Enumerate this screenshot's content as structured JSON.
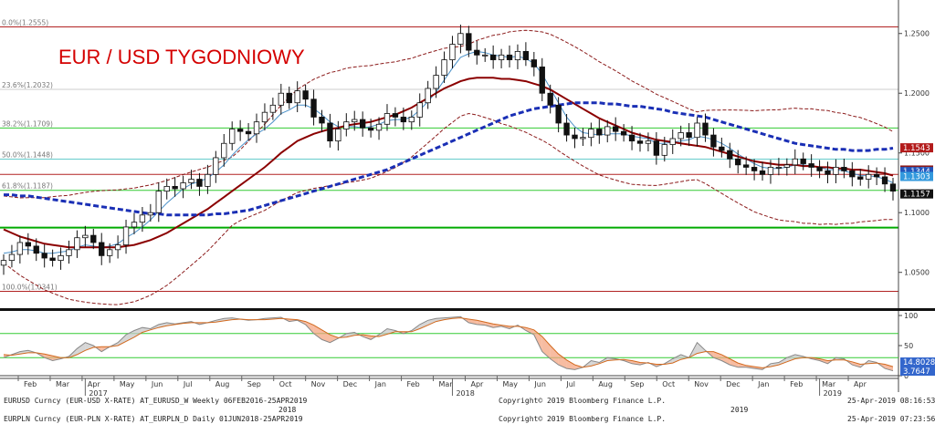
{
  "chart_data": {
    "type": "candlestick",
    "title": "EUR / USD TYGODNIOWY",
    "ylim": [
      1.02,
      1.275
    ],
    "y_ticks": [
      "1.2500",
      "1.2000",
      "1.1500",
      "1.1000",
      "1.0500"
    ],
    "y_tick_values": [
      1.25,
      1.2,
      1.15,
      1.1,
      1.05
    ],
    "month_labels": [
      "Feb",
      "Mar",
      "Apr",
      "May",
      "Jun",
      "Jul",
      "Aug",
      "Sep",
      "Oct",
      "Nov",
      "Dec",
      "Jan",
      "Feb",
      "Mar",
      "Apr",
      "May",
      "Jun",
      "Jul",
      "Aug",
      "Sep",
      "Oct",
      "Nov",
      "Dec",
      "Jan",
      "Feb",
      "Mar",
      "Apr"
    ],
    "year_labels": [
      {
        "text": "2017",
        "index": 10
      },
      {
        "text": "2018",
        "index": 55
      },
      {
        "text": "2019",
        "index": 100
      }
    ],
    "fib_levels": [
      {
        "label": "0.0%(1.2555)",
        "value": 1.2555,
        "color": "#b22222"
      },
      {
        "label": "23.6%(1.2032)",
        "value": 1.2032,
        "color": "#cccccc"
      },
      {
        "label": "38.2%(1.1709)",
        "value": 1.1709,
        "color": "#33cc33"
      },
      {
        "label": "50.0%(1.1448)",
        "value": 1.1448,
        "color": "#66cccc"
      },
      {
        "label": "61.8%(1.1187)",
        "value": 1.1187,
        "color": "#33cc33"
      },
      {
        "label": "",
        "value": 1.0875,
        "color": "#00aa00"
      },
      {
        "label": "100.0%(1.0341)",
        "value": 1.0341,
        "color": "#b22222"
      }
    ],
    "horizontal_lines": [
      {
        "value": 1.132,
        "color": "#b22222"
      }
    ],
    "right_tags": [
      {
        "text": "1.1543",
        "value": 1.1543,
        "color": "#b31b1b"
      },
      {
        "text": "1.1357",
        "value": 1.1357,
        "color": "#8b1a1a"
      },
      {
        "text": "1.1344",
        "value": 1.1344,
        "color": "#2255bb"
      },
      {
        "text": "1.1303",
        "value": 1.1303,
        "color": "#3399dd"
      },
      {
        "text": "1.1157",
        "value": 1.1157,
        "color": "#111111"
      }
    ],
    "close_series": [
      1.06,
      1.065,
      1.075,
      1.072,
      1.066,
      1.062,
      1.06,
      1.064,
      1.069,
      1.079,
      1.081,
      1.075,
      1.064,
      1.069,
      1.073,
      1.088,
      1.092,
      1.098,
      1.1,
      1.118,
      1.122,
      1.12,
      1.125,
      1.128,
      1.122,
      1.132,
      1.146,
      1.158,
      1.17,
      1.168,
      1.166,
      1.176,
      1.184,
      1.19,
      1.2,
      1.192,
      1.202,
      1.195,
      1.18,
      1.175,
      1.16,
      1.17,
      1.176,
      1.178,
      1.171,
      1.169,
      1.174,
      1.183,
      1.18,
      1.176,
      1.18,
      1.192,
      1.204,
      1.215,
      1.228,
      1.241,
      1.25,
      1.236,
      1.232,
      1.232,
      1.228,
      1.232,
      1.228,
      1.235,
      1.228,
      1.222,
      1.2,
      1.19,
      1.175,
      1.165,
      1.162,
      1.163,
      1.17,
      1.165,
      1.172,
      1.168,
      1.165,
      1.16,
      1.158,
      1.16,
      1.148,
      1.157,
      1.162,
      1.167,
      1.163,
      1.175,
      1.165,
      1.155,
      1.152,
      1.145,
      1.14,
      1.138,
      1.135,
      1.132,
      1.138,
      1.138,
      1.14,
      1.145,
      1.141,
      1.138,
      1.135,
      1.132,
      1.138,
      1.135,
      1.13,
      1.128,
      1.132,
      1.13,
      1.124,
      1.118
    ],
    "sma_short": [
      1.066,
      1.067,
      1.069,
      1.069,
      1.068,
      1.066,
      1.066,
      1.067,
      1.068,
      1.071,
      1.073,
      1.072,
      1.071,
      1.072,
      1.074,
      1.079,
      1.083,
      1.088,
      1.094,
      1.101,
      1.108,
      1.114,
      1.12,
      1.124,
      1.126,
      1.129,
      1.134,
      1.14,
      1.148,
      1.155,
      1.161,
      1.166,
      1.17,
      1.176,
      1.183,
      1.186,
      1.19,
      1.19,
      1.187,
      1.182,
      1.176,
      1.172,
      1.172,
      1.172,
      1.171,
      1.172,
      1.174,
      1.177,
      1.178,
      1.178,
      1.18,
      1.186,
      1.193,
      1.201,
      1.211,
      1.221,
      1.23,
      1.233,
      1.235,
      1.234,
      1.232,
      1.231,
      1.23,
      1.231,
      1.229,
      1.225,
      1.216,
      1.204,
      1.192,
      1.18,
      1.172,
      1.167,
      1.166,
      1.165,
      1.166,
      1.166,
      1.166,
      1.164,
      1.163,
      1.162,
      1.158,
      1.158,
      1.159,
      1.16,
      1.161,
      1.164,
      1.163,
      1.161,
      1.158,
      1.154,
      1.149,
      1.145,
      1.141,
      1.138,
      1.137,
      1.137,
      1.138,
      1.14,
      1.14,
      1.139,
      1.138,
      1.136,
      1.136,
      1.135,
      1.133,
      1.131,
      1.131,
      1.13,
      1.128,
      1.125
    ],
    "sma_mid": [
      1.086,
      1.083,
      1.08,
      1.078,
      1.076,
      1.074,
      1.073,
      1.072,
      1.071,
      1.071,
      1.071,
      1.071,
      1.071,
      1.071,
      1.071,
      1.072,
      1.073,
      1.075,
      1.077,
      1.08,
      1.083,
      1.087,
      1.091,
      1.095,
      1.099,
      1.103,
      1.108,
      1.113,
      1.118,
      1.123,
      1.128,
      1.133,
      1.138,
      1.144,
      1.15,
      1.155,
      1.16,
      1.163,
      1.166,
      1.168,
      1.17,
      1.171,
      1.173,
      1.174,
      1.175,
      1.176,
      1.178,
      1.18,
      1.182,
      1.185,
      1.188,
      1.192,
      1.196,
      1.2,
      1.204,
      1.207,
      1.21,
      1.212,
      1.213,
      1.213,
      1.213,
      1.212,
      1.212,
      1.211,
      1.21,
      1.208,
      1.206,
      1.203,
      1.199,
      1.195,
      1.191,
      1.187,
      1.183,
      1.179,
      1.176,
      1.173,
      1.17,
      1.167,
      1.165,
      1.163,
      1.161,
      1.16,
      1.159,
      1.158,
      1.157,
      1.156,
      1.155,
      1.153,
      1.151,
      1.149,
      1.147,
      1.145,
      1.143,
      1.142,
      1.141,
      1.14,
      1.14,
      1.14,
      1.139,
      1.139,
      1.138,
      1.138,
      1.137,
      1.137,
      1.136,
      1.136,
      1.135,
      1.134,
      1.133,
      1.131
    ],
    "sma_long": [
      1.115,
      1.115,
      1.114,
      1.114,
      1.113,
      1.112,
      1.111,
      1.11,
      1.109,
      1.108,
      1.107,
      1.106,
      1.105,
      1.104,
      1.103,
      1.102,
      1.101,
      1.1,
      1.099,
      1.099,
      1.098,
      1.098,
      1.098,
      1.098,
      1.098,
      1.098,
      1.099,
      1.099,
      1.1,
      1.101,
      1.102,
      1.104,
      1.106,
      1.108,
      1.11,
      1.112,
      1.114,
      1.116,
      1.118,
      1.12,
      1.122,
      1.124,
      1.126,
      1.128,
      1.13,
      1.132,
      1.134,
      1.136,
      1.139,
      1.142,
      1.145,
      1.148,
      1.151,
      1.154,
      1.157,
      1.16,
      1.163,
      1.166,
      1.169,
      1.172,
      1.175,
      1.178,
      1.181,
      1.183,
      1.185,
      1.187,
      1.188,
      1.189,
      1.19,
      1.191,
      1.192,
      1.192,
      1.192,
      1.192,
      1.191,
      1.191,
      1.19,
      1.189,
      1.189,
      1.188,
      1.187,
      1.186,
      1.184,
      1.183,
      1.182,
      1.181,
      1.18,
      1.178,
      1.176,
      1.174,
      1.172,
      1.17,
      1.168,
      1.166,
      1.164,
      1.162,
      1.16,
      1.158,
      1.157,
      1.156,
      1.155,
      1.154,
      1.153,
      1.153,
      1.152,
      1.152,
      1.152,
      1.153,
      1.153,
      1.154
    ],
    "oscillator": {
      "ylim": [
        0,
        100
      ],
      "y_ticks": [
        "100",
        "50",
        "0"
      ],
      "y_tick_values": [
        100,
        50,
        0
      ],
      "levels": [
        70,
        30
      ],
      "fast": [
        30,
        35,
        40,
        42,
        38,
        30,
        25,
        28,
        32,
        45,
        55,
        50,
        40,
        48,
        55,
        68,
        75,
        80,
        78,
        85,
        88,
        86,
        88,
        90,
        85,
        88,
        92,
        95,
        96,
        94,
        92,
        93,
        95,
        96,
        97,
        90,
        92,
        85,
        70,
        60,
        55,
        62,
        70,
        72,
        65,
        60,
        68,
        78,
        75,
        70,
        75,
        85,
        92,
        95,
        96,
        97,
        98,
        88,
        85,
        84,
        80,
        82,
        78,
        84,
        75,
        68,
        40,
        28,
        18,
        12,
        10,
        14,
        25,
        22,
        30,
        28,
        25,
        20,
        18,
        22,
        15,
        20,
        28,
        35,
        30,
        55,
        42,
        30,
        25,
        18,
        14,
        14,
        12,
        10,
        20,
        22,
        30,
        35,
        32,
        28,
        25,
        20,
        30,
        28,
        18,
        14,
        25,
        22,
        12,
        8
      ],
      "slow": [
        35,
        34,
        36,
        38,
        38,
        36,
        33,
        30,
        30,
        35,
        42,
        47,
        48,
        48,
        50,
        57,
        64,
        72,
        76,
        80,
        83,
        85,
        87,
        88,
        88,
        88,
        89,
        91,
        93,
        94,
        93,
        93,
        93,
        94,
        95,
        94,
        93,
        90,
        84,
        76,
        68,
        63,
        64,
        67,
        68,
        66,
        65,
        69,
        73,
        73,
        73,
        78,
        84,
        90,
        93,
        95,
        96,
        94,
        92,
        89,
        86,
        84,
        82,
        82,
        80,
        76,
        65,
        50,
        36,
        26,
        18,
        14,
        16,
        20,
        25,
        26,
        27,
        25,
        22,
        21,
        19,
        19,
        21,
        27,
        30,
        37,
        40,
        40,
        35,
        28,
        21,
        17,
        15,
        13,
        15,
        18,
        23,
        28,
        30,
        30,
        28,
        25,
        26,
        26,
        23,
        19,
        20,
        21,
        19,
        15
      ],
      "tags": [
        {
          "text": "14.8028",
          "color": "#3366cc"
        },
        {
          "text": "3.7647",
          "color": "#3366cc"
        }
      ]
    }
  },
  "footer": {
    "line1_left": "EURUSD Curncy (EUR-USD X-RATE) AT_EURUSD_W  Weekly 06FEB2016-25APR2019",
    "line1_mid": "Copyright© 2019 Bloomberg Finance L.P.",
    "line1_right": "25-Apr-2019 08:16:53",
    "line2_left": "EURPLN Curncy (EUR-PLN X-RATE) AT_EURPLN_D  Daily 01JUN2018-25APR2019",
    "line2_mid": "Copyright© 2019 Bloomberg Finance L.P.",
    "line2_right": "25-Apr-2019 07:23:56",
    "year_2018": "2018",
    "year_2019": "2019"
  },
  "colors": {
    "up_candle": "#ffffff",
    "down_candle": "#111111",
    "sma_short": "#4a90c8",
    "sma_mid": "#8b0000",
    "sma_long": "#1a2fb5",
    "bollinger": "#8b1a1a",
    "osc_fast": "#888888",
    "osc_slow": "#d2691e"
  }
}
